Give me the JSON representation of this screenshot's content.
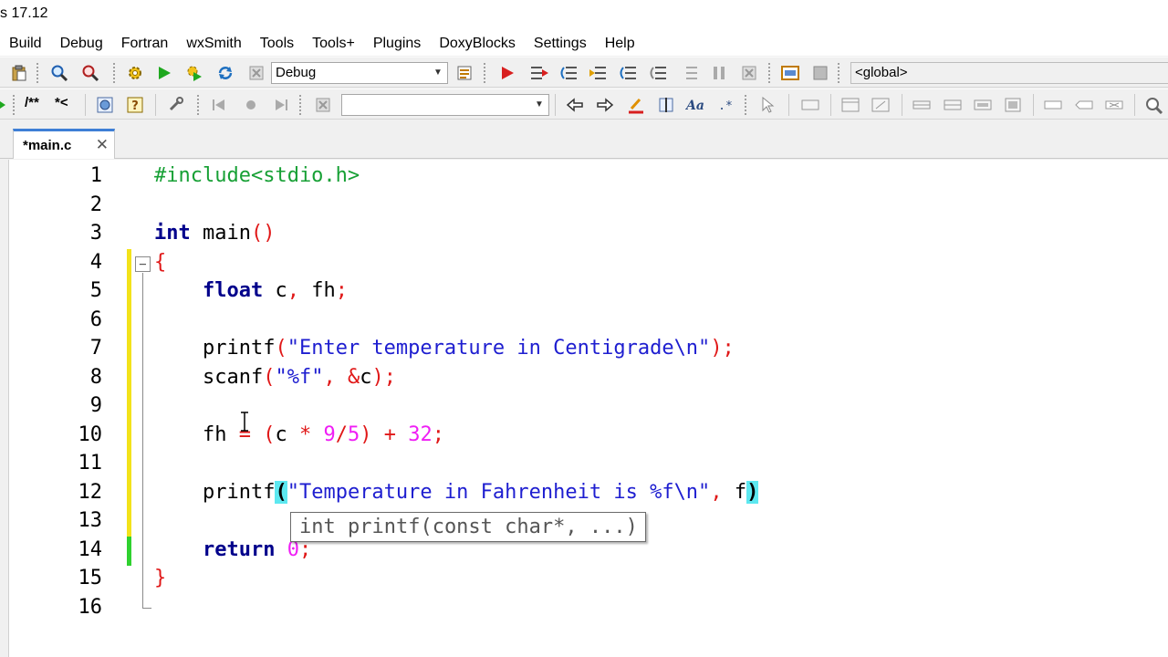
{
  "window": {
    "title": "s 17.12"
  },
  "menu": [
    "Build",
    "Debug",
    "Fortran",
    "wxSmith",
    "Tools",
    "Tools+",
    "Plugins",
    "DoxyBlocks",
    "Settings",
    "Help"
  ],
  "toolbar": {
    "build_target": "Debug",
    "scope": "<global>",
    "comment_block": "/**",
    "comment_line": "*<",
    "search_value": ""
  },
  "tabs": [
    {
      "label": "*main.c",
      "close": "✕"
    }
  ],
  "editor": {
    "lines": [
      {
        "n": "1"
      },
      {
        "n": "2"
      },
      {
        "n": "3"
      },
      {
        "n": "4"
      },
      {
        "n": "5"
      },
      {
        "n": "6"
      },
      {
        "n": "7"
      },
      {
        "n": "8"
      },
      {
        "n": "9"
      },
      {
        "n": "10"
      },
      {
        "n": "11"
      },
      {
        "n": "12"
      },
      {
        "n": "13"
      },
      {
        "n": "14"
      },
      {
        "n": "15"
      },
      {
        "n": "16"
      }
    ],
    "code": {
      "l1_include": "#include<stdio.h>",
      "l3_kw": "int",
      "l3_name": " main",
      "l3_parens": "()",
      "l4_brace": "{",
      "l5_indent": "    ",
      "l5_kw": "float",
      "l5_rest1": " c",
      "l5_comma": ",",
      "l5_rest2": " fh",
      "l5_semi": ";",
      "l7_indent": "    ",
      "l7_fn": "printf",
      "l7_open": "(",
      "l7_str": "\"Enter temperature in Centigrade\\n\"",
      "l7_close": ");",
      "l8_indent": "    ",
      "l8_fn": "scanf",
      "l8_open": "(",
      "l8_str": "\"%f\"",
      "l8_comma": ", &",
      "l8_var": "c",
      "l8_close": ");",
      "l10_indent": "    ",
      "l10_var": "fh",
      "l10_eq": " = (",
      "l10_c": "c",
      "l10_mul": " * ",
      "l10_9": "9",
      "l10_div": "/",
      "l10_5": "5",
      "l10_plus": ") + ",
      "l10_32": "32",
      "l10_semi": ";",
      "l12_indent": "    ",
      "l12_fn": "printf",
      "l12_open": "(",
      "l12_str": "\"Temperature in Fahrenheit is %f\\n\"",
      "l12_comma": ", ",
      "l12_var": "f",
      "l12_close": ")",
      "l14_indent": "    ",
      "l14_kw": "return",
      "l14_sp": " ",
      "l14_num": "0",
      "l14_semi": ";",
      "l15_brace": "}"
    },
    "calltip": "int printf(const char*, ...)"
  },
  "colors": {
    "preprocessor": "#17a035",
    "keyword": "#00008b",
    "operator": "#e01818",
    "number": "#ef1ef5",
    "string": "#1e1ed0",
    "brace_highlight": "#5de8f0",
    "changed_line": "#f3e21a",
    "saved_line": "#2fd12f"
  }
}
